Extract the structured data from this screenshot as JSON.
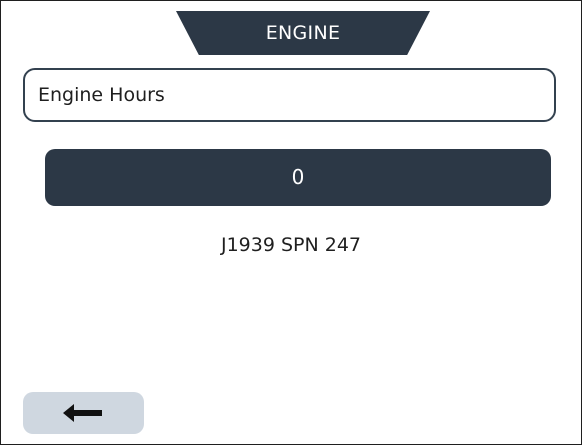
{
  "header": {
    "title": "ENGINE"
  },
  "parameter": {
    "name": "Engine Hours",
    "value": "0",
    "spn": "J1939 SPN 247"
  },
  "footer": {
    "back_button_icon": "left-arrow-icon"
  }
}
